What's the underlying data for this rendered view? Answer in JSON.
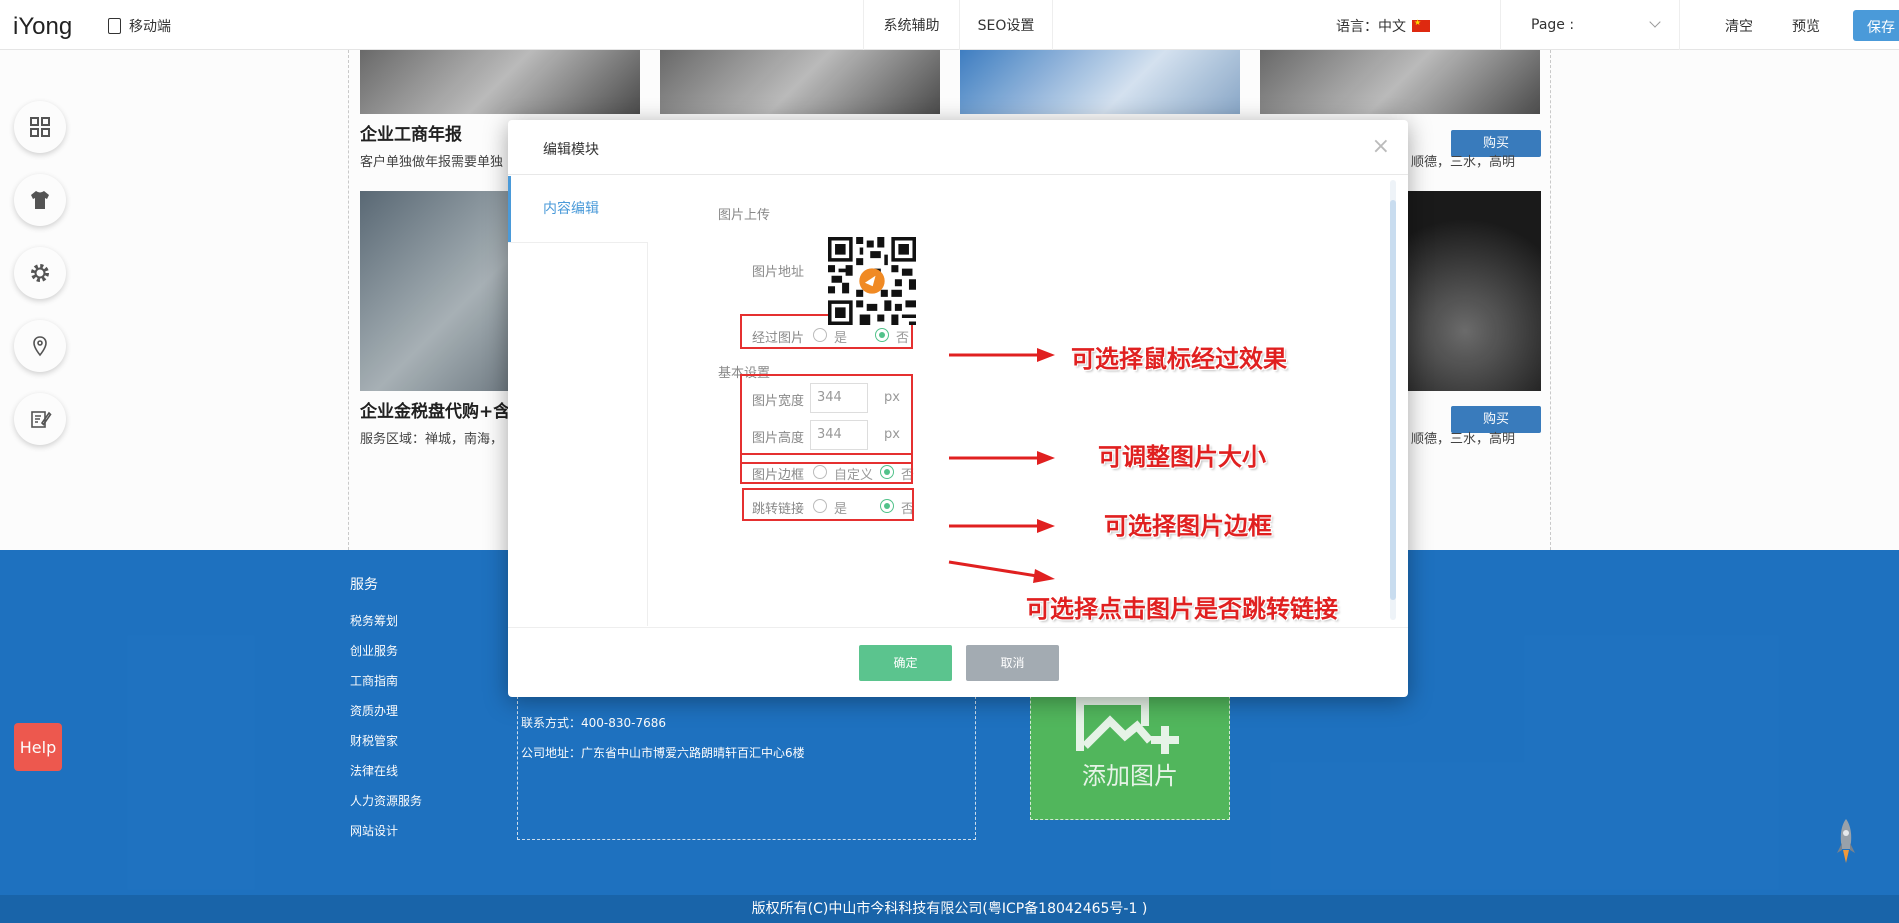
{
  "topbar": {
    "logo": "iYong",
    "mobile_label": "移动端",
    "nav_assist": "系统辅助",
    "nav_seo": "SEO设置",
    "language": "语言：中文",
    "page_label": "Page :",
    "clear": "清空",
    "preview": "预览",
    "save": "保存"
  },
  "tools": [
    "grid-icon",
    "tshirt-icon",
    "gear-icon",
    "location-pin-icon",
    "edit-note-icon"
  ],
  "products": [
    {
      "title": "企业工商年报",
      "desc": "客户单独做年报需要单独",
      "buy": "购买",
      "desc_right": "顺德，三水，高明"
    },
    {
      "title": "企业金税盘代购+含发",
      "desc": "服务区域：禅城，南海，",
      "buy": "购买",
      "desc_right": "顺德，三水，高明"
    }
  ],
  "footer": {
    "service_title": "服务",
    "service_items": [
      "税务筹划",
      "创业服务",
      "工商指南",
      "资质办理",
      "财税管家",
      "法律在线",
      "人力资源服务",
      "网站设计"
    ],
    "contact_phone": "联系方式：400-830-7686",
    "contact_address": "公司地址：广东省中山市博爱六路朗晴轩百汇中心6楼",
    "add_image": "添加图片",
    "copyright": "版权所有(C)中山市今科科技有限公司(粤ICP备18042465号-1 )"
  },
  "help": "Help",
  "modal": {
    "title": "编辑模块",
    "close": "×",
    "tab": "内容编辑",
    "image_upload": "图片上传",
    "image_url_label": "图片地址",
    "hover_label": "经过图片",
    "yes": "是",
    "no": "否",
    "basic_settings": "基本设置",
    "width_label": "图片宽度",
    "width_value": "344",
    "height_label": "图片高度",
    "height_value": "344",
    "unit": "px",
    "border_label": "图片边框",
    "custom": "自定义",
    "link_label": "跳转链接",
    "ok": "确定",
    "cancel": "取消"
  },
  "annotations": {
    "hover": "可选择鼠标经过效果",
    "size": "可调整图片大小",
    "border": "可选择图片边框",
    "link": "可选择点击图片是否跳转链接"
  },
  "colors": {
    "accent": "#4a9ad9",
    "footer": "#1f73c2",
    "annotation": "#e02020",
    "confirm": "#5bc48e"
  }
}
